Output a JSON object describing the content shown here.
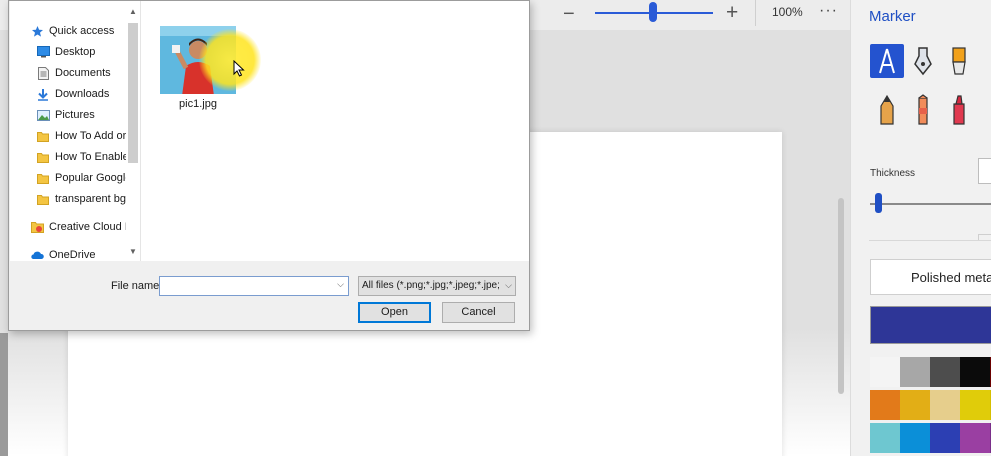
{
  "toolbar": {
    "zoom_out": "−",
    "zoom_in": "+",
    "zoom_percent": "100%",
    "more": "···",
    "zoom_level": 0.46
  },
  "panel": {
    "title": "Marker",
    "thickness_label": "Thickness",
    "thickness_level": 0.04,
    "material_label": "Polished metal",
    "selected_color": "#2e3697",
    "swatches": [
      [
        "#f4f4f4",
        "#a7a7a7",
        "#4d4d4d",
        "#0b0b0b",
        "#6a0000"
      ],
      [
        "#e27a1a",
        "#e2ae16",
        "#e6ce8c",
        "#e0cc0a",
        "#d6bf00"
      ],
      [
        "#6ec7d0",
        "#0b8fd8",
        "#2c3fb3",
        "#9a3fa2",
        "#7a2f8a"
      ]
    ],
    "tools": [
      "calligraphy-pen-icon",
      "ink-pen-icon",
      "marker-icon",
      "pencil-icon",
      "crayon-icon",
      "highlighter-icon"
    ]
  },
  "dialog": {
    "nav": {
      "quick_access": "Quick access",
      "items": [
        {
          "label": "Desktop",
          "icon": "desktop-icon",
          "pinned": true
        },
        {
          "label": "Documents",
          "icon": "documents-icon",
          "pinned": true
        },
        {
          "label": "Downloads",
          "icon": "downloads-icon",
          "pinned": true
        },
        {
          "label": "Pictures",
          "icon": "pictures-icon",
          "pinned": true
        },
        {
          "label": "How To Add or C",
          "icon": "folder-icon",
          "pinned": false
        },
        {
          "label": "How To Enable D",
          "icon": "folder-icon",
          "pinned": false
        },
        {
          "label": "Popular Google I",
          "icon": "folder-icon",
          "pinned": false
        },
        {
          "label": "transparent bg",
          "icon": "folder-icon",
          "pinned": false
        }
      ],
      "creative_cloud": "Creative Cloud File",
      "onedrive": "OneDrive"
    },
    "files": [
      {
        "name": "pic1.jpg"
      }
    ],
    "file_name_label": "File name:",
    "file_name_value": "",
    "filter": "All files (*.png;*.jpg;*.jpeg;*.jpe;",
    "open_label": "Open",
    "cancel_label": "Cancel"
  }
}
